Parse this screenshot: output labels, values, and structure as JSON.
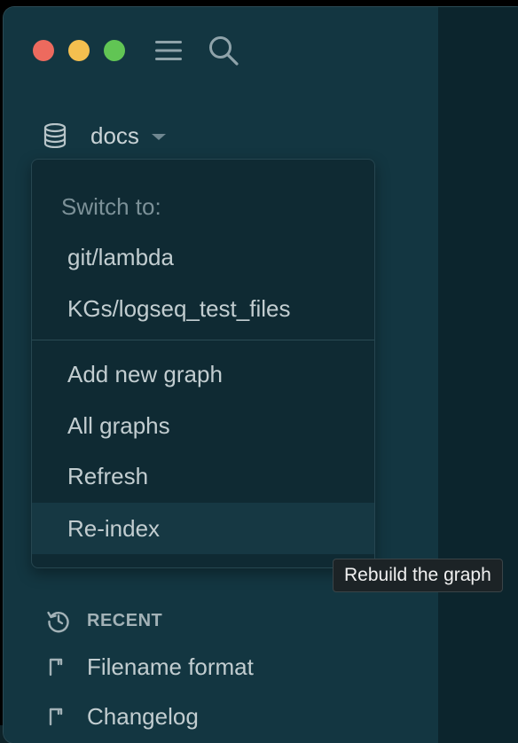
{
  "window": {
    "traffic_lights": [
      "close",
      "minimize",
      "maximize"
    ]
  },
  "toolbar": {
    "menu_icon": "hamburger-menu-icon",
    "search_icon": "search-icon"
  },
  "graph": {
    "current": "docs",
    "icon": "database-icon"
  },
  "dropdown": {
    "heading": "Switch to:",
    "graphs": [
      "git/lambda",
      "KGs/logseq_test_files"
    ],
    "actions": [
      "Add new graph",
      "All graphs",
      "Refresh",
      "Re-index"
    ]
  },
  "tooltip": {
    "text": "Rebuild the graph"
  },
  "recent": {
    "label": "RECENT",
    "icon": "history-icon",
    "items": [
      "Filename format",
      "Changelog"
    ]
  },
  "colors": {
    "sidebar_bg": "#133641",
    "dropdown_bg": "#0f2a33",
    "hover_bg": "#163843",
    "text": "#c2cdd0",
    "muted": "#7c9198"
  }
}
